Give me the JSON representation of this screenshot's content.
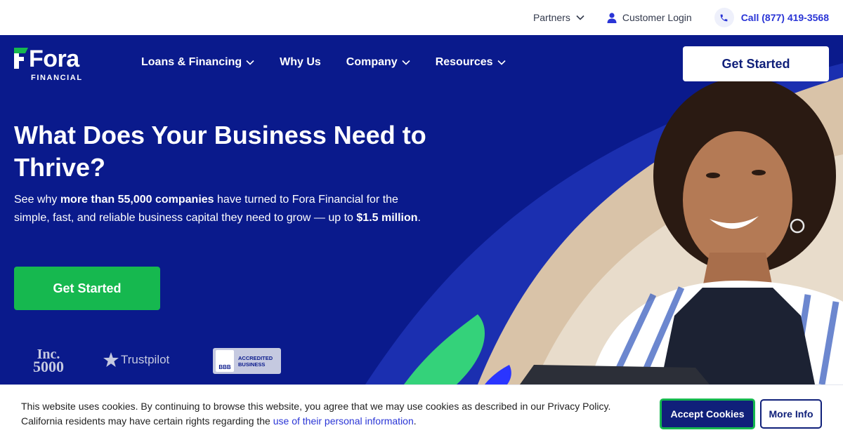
{
  "topbar": {
    "partners_label": "Partners",
    "login_label": "Customer Login",
    "phone_label": "Call (877) 419-3568",
    "icons": {
      "partners": "chevron-down-icon",
      "login": "user-icon",
      "phone": "phone-icon"
    },
    "phone_color": "#2a35d6"
  },
  "brand": {
    "name": "Fora",
    "subname": "FINANCIAL",
    "accent": "#16b84f",
    "primary": "#0a1a8c"
  },
  "nav": {
    "items": [
      {
        "label": "Loans & Financing",
        "has_dropdown": true
      },
      {
        "label": "Why Us",
        "has_dropdown": false
      },
      {
        "label": "Company",
        "has_dropdown": true
      },
      {
        "label": "Resources",
        "has_dropdown": true
      }
    ],
    "cta_label": "Get Started"
  },
  "hero": {
    "headline": "What Does Your Business Need to Thrive?",
    "sub_part1": "See why ",
    "sub_bold1": "more than 55,000 companies",
    "sub_part2": " have turned to Fora Financial for the simple, fast, and reliable business capital they need to grow — up to ",
    "sub_bold2": "$1.5 million",
    "sub_part3": ".",
    "cta_label": "Get Started"
  },
  "badges": {
    "inc_line1": "Inc.",
    "inc_line2": "5000",
    "trustpilot": "Trustpilot",
    "bbb_logo": "BBB",
    "bbb_line1": "ACCREDITED",
    "bbb_line2": "BUSINESS"
  },
  "cookie": {
    "text_part1": "This website uses cookies. By continuing to browse this website, you agree that we may use cookies as described in our Privacy Policy. California residents may have certain rights regarding the ",
    "link_text": "use of their personal information",
    "text_part2": ".",
    "accept_label": "Accept Cookies",
    "more_label": "More Info"
  }
}
